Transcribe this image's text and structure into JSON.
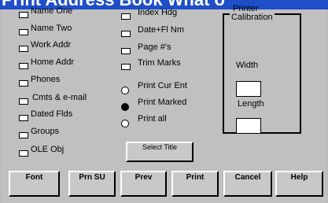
{
  "window": {
    "title": "Print Address Book What o"
  },
  "fields": [
    "Name One",
    "Name Two",
    "Work Addr",
    "Home Addr",
    "Phones",
    "Cmts & e-mail",
    "Dated Flds",
    "Groups",
    "OLE Obj"
  ],
  "options": [
    "Index Hdg",
    "Date+Fl Nm",
    "Page #'s",
    "Trim Marks"
  ],
  "print_scope": {
    "items": [
      "Print Cur Ent",
      "Print Marked",
      "Print all"
    ],
    "selected": "Print Marked"
  },
  "select_title_button": "Select Title",
  "calibration": {
    "header": "Printer",
    "title": "Calibration",
    "width_label": "Width",
    "length_label": "Length",
    "width_value": "",
    "length_value": ""
  },
  "buttons": {
    "font": "Font",
    "prn_su": "Prn SU",
    "prev": "Prev",
    "print": "Print",
    "cancel": "Cancel",
    "help": "Help"
  }
}
